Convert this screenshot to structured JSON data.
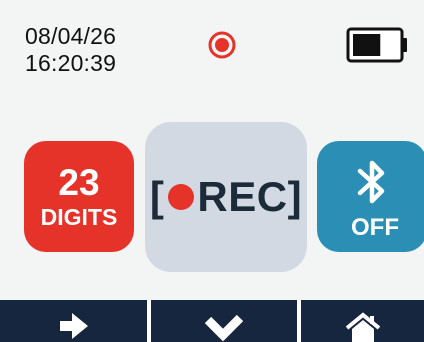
{
  "status": {
    "date": "08/04/26",
    "time": "16:20:39",
    "recording_indicator_icon": "record-dot-icon",
    "battery_icon": "battery-icon",
    "battery_level": 0.62
  },
  "tiles": {
    "digits": {
      "count": "23",
      "label": "DIGITS",
      "color": "#e5332a"
    },
    "record": {
      "open_bracket": "[",
      "label": "REC]",
      "color": "#d2d9e2"
    },
    "bluetooth": {
      "icon": "bluetooth-icon",
      "state": "OFF",
      "color": "#2b8fb5"
    }
  },
  "nav": {
    "next_icon": "arrow-right-icon",
    "confirm_icon": "checkmark-icon",
    "home_icon": "home-icon",
    "color": "#16263e"
  }
}
